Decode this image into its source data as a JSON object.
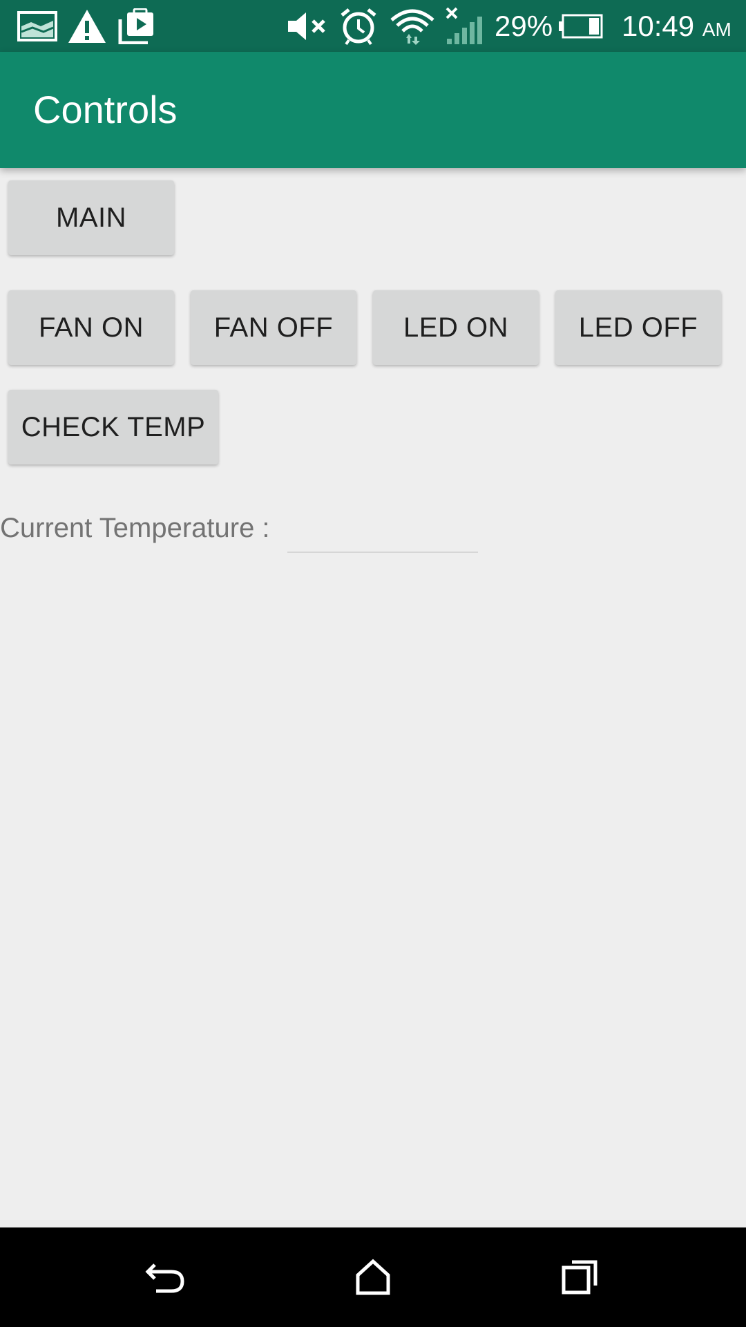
{
  "status_bar": {
    "battery_percent": "29%",
    "time": "10:49",
    "ampm": "AM",
    "icons": [
      "gallery-icon",
      "warning-icon",
      "work-profile-icon",
      "mute-icon",
      "alarm-icon",
      "wifi-icon",
      "no-signal-icon",
      "battery-icon"
    ]
  },
  "app_bar": {
    "title": "Controls"
  },
  "buttons": {
    "main": "MAIN",
    "fan_on": "FAN ON",
    "fan_off": "FAN OFF",
    "led_on": "LED ON",
    "led_off": "LED OFF",
    "check_temp": "CHECK TEMP"
  },
  "temperature": {
    "label": "Current Temperature :",
    "value": ""
  },
  "nav_bar": {
    "icons": [
      "back-icon",
      "home-icon",
      "recents-icon"
    ]
  },
  "colors": {
    "status_bar": "#0e6b54",
    "app_bar": "#10896b",
    "button": "#d6d7d7",
    "background": "#eeeeee"
  }
}
